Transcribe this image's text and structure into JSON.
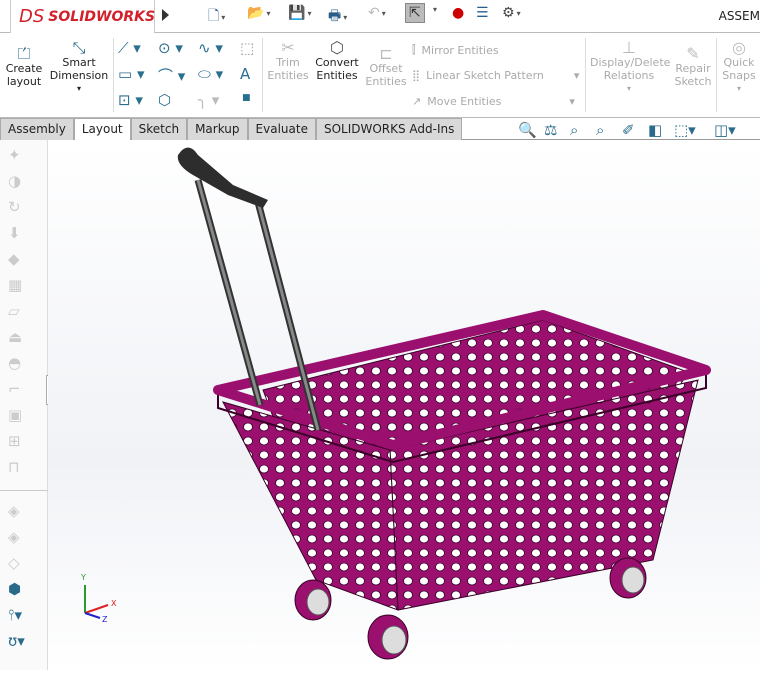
{
  "app": {
    "brand": "SOLIDWORKS",
    "brand_prefix": "DS",
    "title": "ASSEM"
  },
  "ribbon": {
    "create_layout": "Create layout",
    "smart_dimension": "Smart Dimension",
    "trim_entities": "Trim Entities",
    "convert_entities": "Convert Entities",
    "offset_entities": "Offset Entities",
    "mirror_entities": "Mirror Entities",
    "linear_sketch_pattern": "Linear Sketch Pattern",
    "move_entities": "Move Entities",
    "display_delete_relations": "Display/Delete Relations",
    "repair_sketch": "Repair Sketch",
    "quick_snaps": "Quick Snaps"
  },
  "tabs": [
    "Assembly",
    "Layout",
    "Sketch",
    "Markup",
    "Evaluate",
    "SOLIDWORKS Add-Ins"
  ],
  "active_tab": "Layout",
  "triad": {
    "x": "X",
    "y": "Y",
    "z": "Z"
  },
  "colors": {
    "basket": "#9b0f6f",
    "accent": "#d4202a"
  }
}
